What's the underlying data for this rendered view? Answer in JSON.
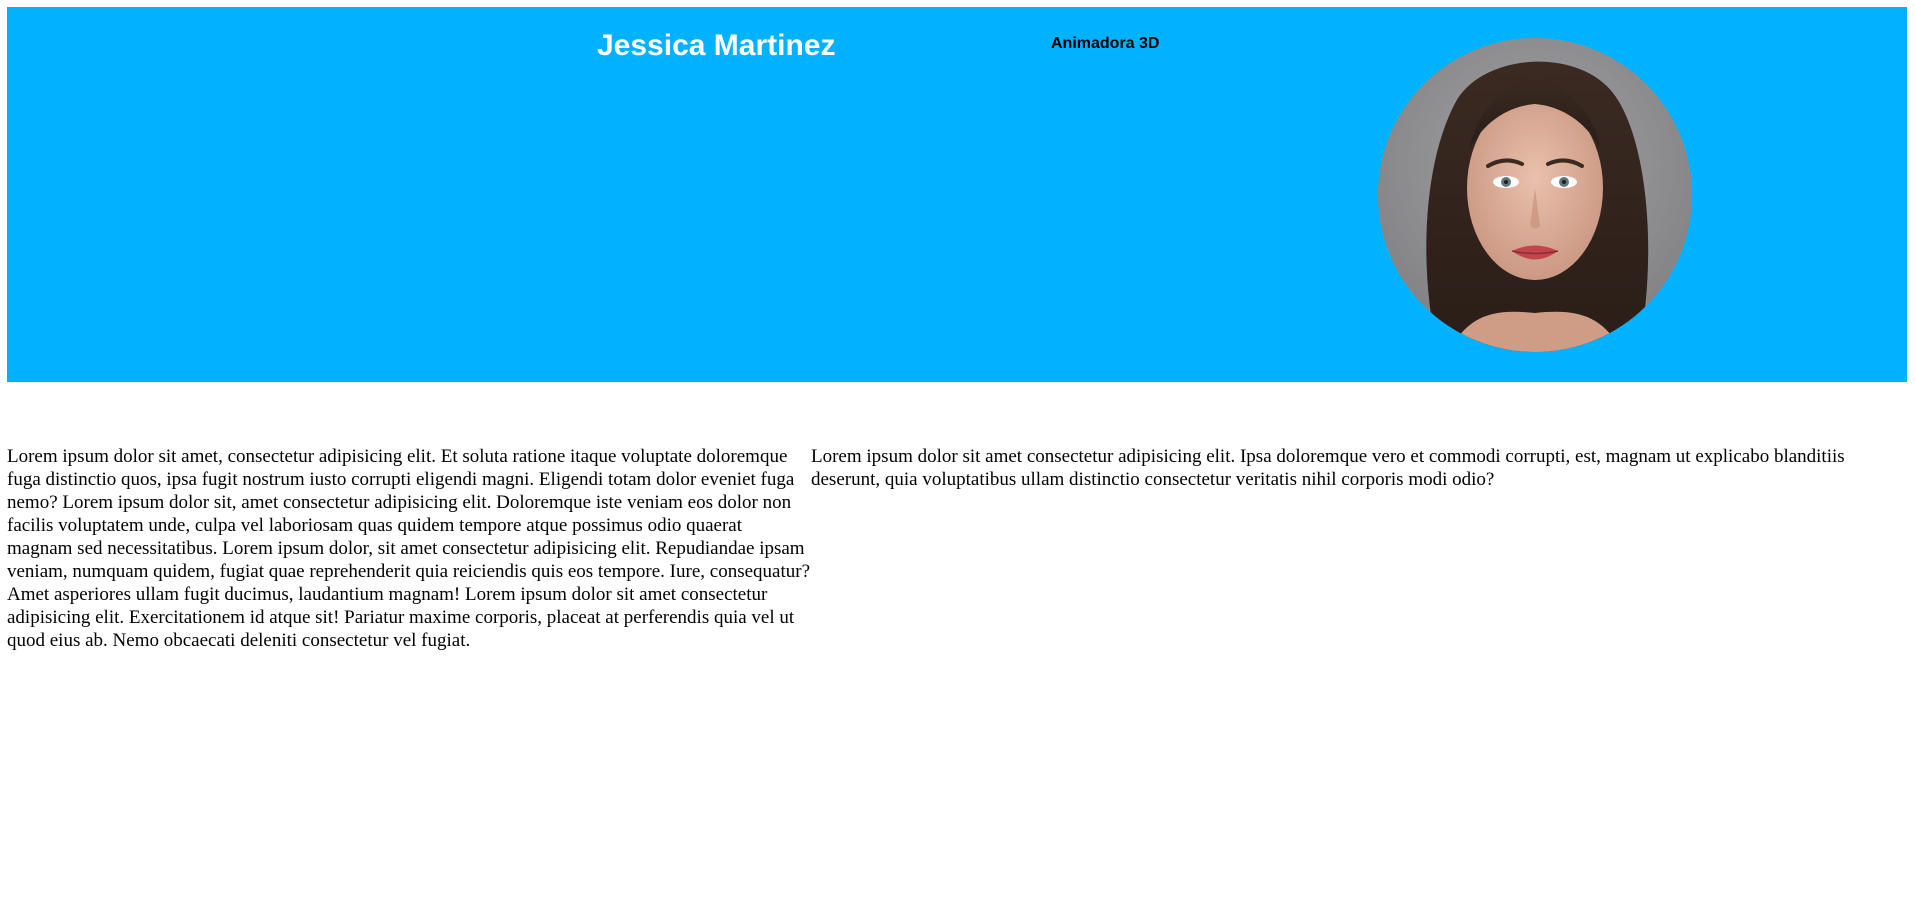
{
  "header": {
    "name": "Jessica Martinez",
    "role": "Animadora 3D",
    "background_color": "#00b2ff",
    "avatar_icon": "portrait-photo"
  },
  "content": {
    "left_paragraph": "Lorem ipsum dolor sit amet, consectetur adipisicing elit. Et soluta ratione itaque voluptate doloremque fuga distinctio quos, ipsa fugit nostrum iusto corrupti eligendi magni. Eligendi totam dolor eveniet fuga nemo? Lorem ipsum dolor sit, amet consectetur adipisicing elit. Doloremque iste veniam eos dolor non facilis voluptatem unde, culpa vel laboriosam quas quidem tempore atque possimus odio quaerat magnam sed necessitatibus. Lorem ipsum dolor, sit amet consectetur adipisicing elit. Repudiandae ipsam veniam, numquam quidem, fugiat quae reprehenderit quia reiciendis quis eos tempore. Iure, consequatur? Amet asperiores ullam fugit ducimus, laudantium magnam! Lorem ipsum dolor sit amet consectetur adipisicing elit. Exercitationem id atque sit! Pariatur maxime corporis, placeat at perferendis quia vel ut quod eius ab. Nemo obcaecati deleniti consectetur vel fugiat.",
    "right_paragraph": "Lorem ipsum dolor sit amet consectetur adipisicing elit. Ipsa doloremque vero et commodi corrupti, est, magnam ut explicabo blanditiis deserunt, quia voluptatibus ullam distinctio consectetur veritatis nihil corporis modi odio?"
  }
}
